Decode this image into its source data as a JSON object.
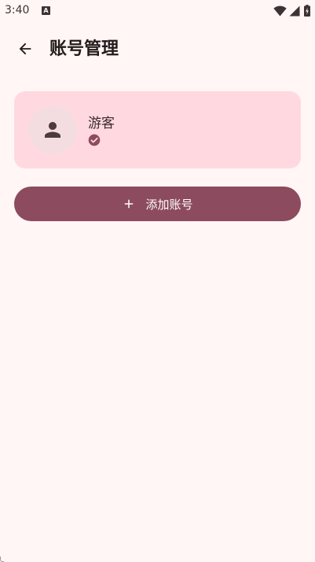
{
  "status_bar": {
    "time": "3:40",
    "notification_letter": "A"
  },
  "app_bar": {
    "title": "账号管理"
  },
  "accounts": [
    {
      "name": "游客",
      "selected": true
    }
  ],
  "actions": {
    "add_account_label": "添加账号"
  },
  "colors": {
    "background": "#fff6f5",
    "card": "#ffd9df",
    "primary": "#8c4b5e"
  }
}
